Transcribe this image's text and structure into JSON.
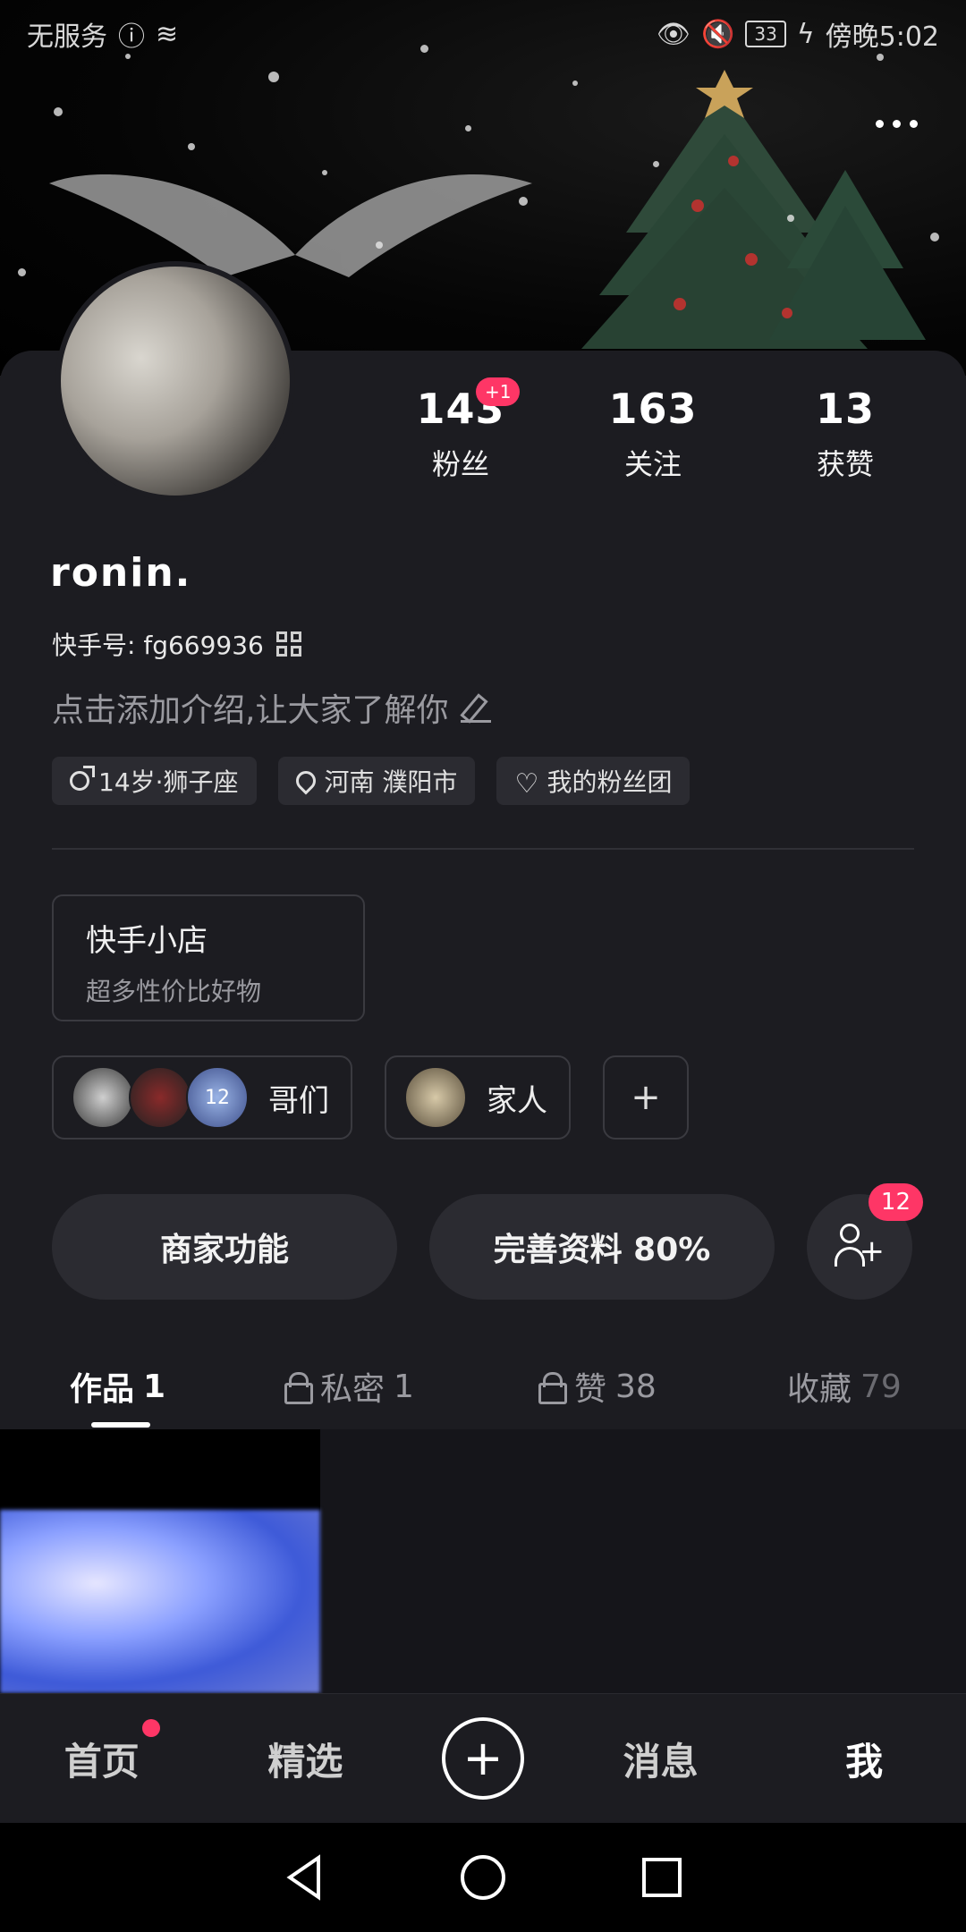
{
  "status_bar": {
    "left_text": "无服务",
    "battery": "33",
    "time": "傍晚5:02"
  },
  "profile": {
    "stats": [
      {
        "value": "143",
        "label": "粉丝",
        "badge": "+1"
      },
      {
        "value": "163",
        "label": "关注"
      },
      {
        "value": "13",
        "label": "获赞"
      }
    ],
    "username": "ronin.",
    "ks_id": "快手号: fg669936",
    "bio_placeholder": "点击添加介绍,让大家了解你",
    "tags": [
      {
        "icon": "male-icon",
        "label": "14岁·狮子座"
      },
      {
        "icon": "location-icon",
        "label": "河南 濮阳市"
      },
      {
        "icon": "heart-icon",
        "label": "我的粉丝团"
      }
    ]
  },
  "shop": {
    "title": "快手小店",
    "subtitle": "超多性价比好物"
  },
  "groups": [
    {
      "name": "哥们",
      "count_label": "12"
    },
    {
      "name": "家人"
    }
  ],
  "actions": {
    "merchant": "商家功能",
    "complete_profile": "完善资料 80%",
    "friend_badge": "12"
  },
  "tabs": [
    {
      "label": "作品",
      "count": "1",
      "locked": false,
      "active": true
    },
    {
      "label": "私密",
      "count": "1",
      "locked": true
    },
    {
      "label": "赞",
      "count": "38",
      "locked": true
    },
    {
      "label": "收藏",
      "count": "79",
      "locked": false
    }
  ],
  "bottom_nav": {
    "home": "首页",
    "featured": "精选",
    "messages": "消息",
    "me": "我"
  },
  "colors": {
    "accent": "#fe3666",
    "background": "#1c1c21",
    "card": "#2b2b31"
  }
}
